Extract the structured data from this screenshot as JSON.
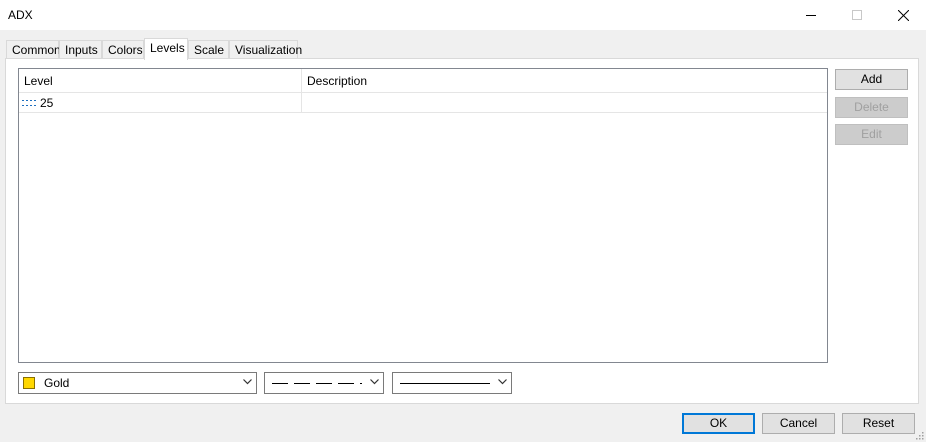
{
  "window": {
    "title": "ADX"
  },
  "tabs": [
    {
      "label": "Common"
    },
    {
      "label": "Inputs"
    },
    {
      "label": "Colors"
    },
    {
      "label": "Levels",
      "active": true
    },
    {
      "label": "Scale"
    },
    {
      "label": "Visualization"
    }
  ],
  "levels": {
    "columns": [
      "Level",
      "Description"
    ],
    "rows": [
      {
        "level": "25",
        "description": ""
      }
    ]
  },
  "side_buttons": {
    "add": "Add",
    "delete": "Delete",
    "edit": "Edit"
  },
  "style": {
    "color_name": "Gold",
    "color_hex": "#ffd700",
    "line_style_icon": "dashed-line-icon",
    "line_width_icon": "solid-line-icon"
  },
  "dialog_buttons": {
    "ok": "OK",
    "cancel": "Cancel",
    "reset": "Reset"
  }
}
